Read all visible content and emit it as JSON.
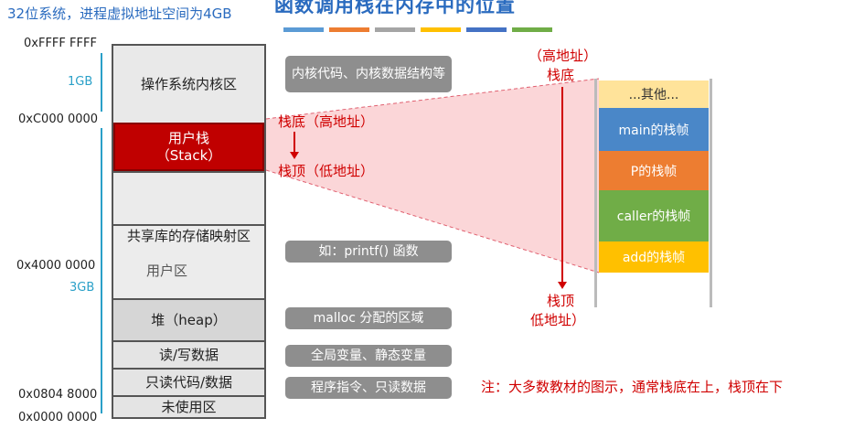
{
  "header": {
    "note": "32位系统，进程虚拟地址空间为4GB",
    "title": "函数调用栈在内存中的位置",
    "bar_colors": [
      "#5b9bd5",
      "#ed7d31",
      "#a5a5a5",
      "#ffc000",
      "#4472c4",
      "#70ad47"
    ]
  },
  "addresses": {
    "a0": "0xFFFF FFFF",
    "a1": "0xC000 0000",
    "a2": "0x4000 0000",
    "a3": "0x0804 8000",
    "a4": "0x0000 0000"
  },
  "sizes": {
    "kernel": "1GB",
    "user": "3GB"
  },
  "segments": {
    "kernel": "操作系统内核区",
    "user_stack": "用户栈",
    "user_stack_en": "（Stack）",
    "shared_lib": "共享库的存储映射区",
    "user_area": "用户区",
    "heap": "堆（heap）",
    "rw_data": "读/写数据",
    "ro_code": "只读代码/数据",
    "unused": "未使用区"
  },
  "callouts": {
    "kernel": "内核代码、内核数据结构等",
    "shared": "如：printf() 函数",
    "heap": "malloc 分配的区域",
    "rw": "全局变量、静态变量",
    "ro": "程序指令、只读数据"
  },
  "stack_labels": {
    "bottom_left": "栈底（高地址）",
    "top_left": "栈顶（低地址）",
    "high_addr": "（高地址）",
    "bottom": "栈底",
    "top": "栈顶",
    "low_addr": "低地址）"
  },
  "frames": [
    "...其他...",
    "main的栈帧",
    "P的栈帧",
    "caller的栈帧",
    "add的栈帧"
  ],
  "note": "注：大多数教材的图示，通常栈底在上，栈顶在下"
}
